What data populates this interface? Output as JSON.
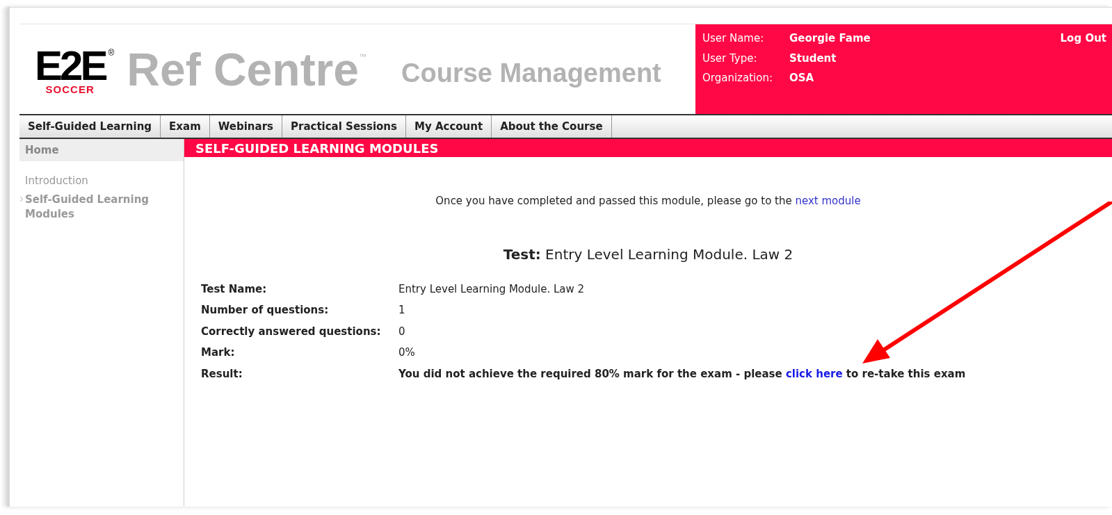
{
  "logo": {
    "mark": "E2E",
    "registered": "®",
    "subtitle": "SOCCER"
  },
  "brand": {
    "title": "Ref Centre",
    "trademark": "™",
    "section": "Course Management"
  },
  "user_panel": {
    "fields": [
      {
        "label": "User Name:",
        "value": "Georgie Fame"
      },
      {
        "label": "User Type:",
        "value": "Student"
      },
      {
        "label": "Organization:",
        "value": "OSA"
      }
    ],
    "logout": "Log Out"
  },
  "tabs": [
    {
      "label": "Self-Guided Learning"
    },
    {
      "label": "Exam"
    },
    {
      "label": "Webinars"
    },
    {
      "label": "Practical Sessions"
    },
    {
      "label": "My Account"
    },
    {
      "label": "About the Course"
    }
  ],
  "sidebar": {
    "header": "Home",
    "items": [
      {
        "label": "Introduction",
        "selected": false
      },
      {
        "label": "Self-Guided Learning Modules",
        "selected": true
      }
    ]
  },
  "banner": "SELF-GUIDED LEARNING MODULES",
  "notice": {
    "text": "Once you have completed and passed this module, please go to the ",
    "link": "next module"
  },
  "test_heading": {
    "label": "Test:",
    "value": "Entry Level Learning Module. Law 2"
  },
  "details": [
    {
      "label": "Test Name:",
      "value": "Entry Level Learning Module. Law 2"
    },
    {
      "label": "Number of questions:",
      "value": "1"
    },
    {
      "label": "Correctly answered questions:",
      "value": "0"
    },
    {
      "label": "Mark:",
      "value": "0%"
    }
  ],
  "result": {
    "label": "Result:",
    "before": "You did not achieve the required 80% mark for the exam - please ",
    "link": "click here",
    "after": " to re-take this exam"
  }
}
